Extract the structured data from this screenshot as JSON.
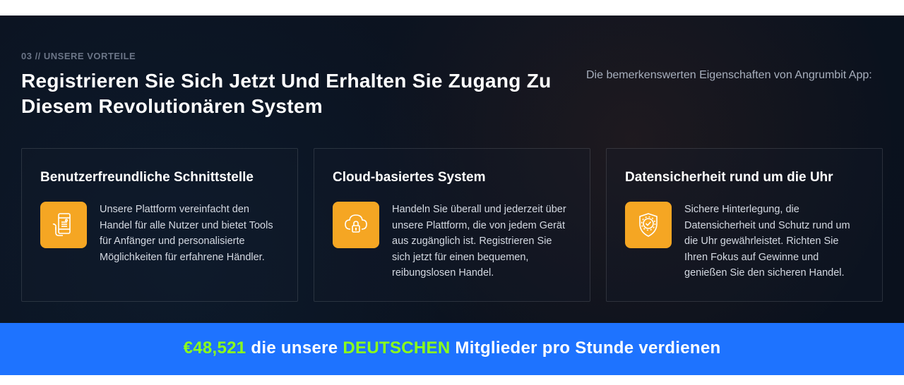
{
  "eyebrow": "03 // UNSERE VORTEILE",
  "main_heading": "Registrieren Sie Sich Jetzt Und Erhalten Sie Zugang Zu Diesem Revolutionären System",
  "sub_text": "Die bemerkenswerten Eigenschaften von Angrumbit App:",
  "cards": [
    {
      "title": "Benutzerfreundliche Schnittstelle",
      "desc": "Unsere Plattform vereinfacht den Handel für alle Nutzer und bietet Tools für Anfänger und personalisierte Möglichkeiten für erfahrene Händler."
    },
    {
      "title": "Cloud-basiertes System",
      "desc": "Handeln Sie überall und jederzeit über unsere Plattform, die von jedem Gerät aus zugänglich ist. Registrieren Sie sich jetzt für einen bequemen, reibungslosen Handel."
    },
    {
      "title": "Datensicherheit rund um die Uhr",
      "desc": "Sichere Hinterlegung, die Datensicherheit und Schutz rund um die Uhr gewährleistet. Richten Sie Ihren Fokus auf Gewinne und genießen Sie den sicheren Handel."
    }
  ],
  "banner": {
    "amount": "€48,521",
    "text_a": " die unsere ",
    "highlight": "DEUTSCHEN",
    "text_b": " Mitglieder pro Stunde verdienen"
  }
}
